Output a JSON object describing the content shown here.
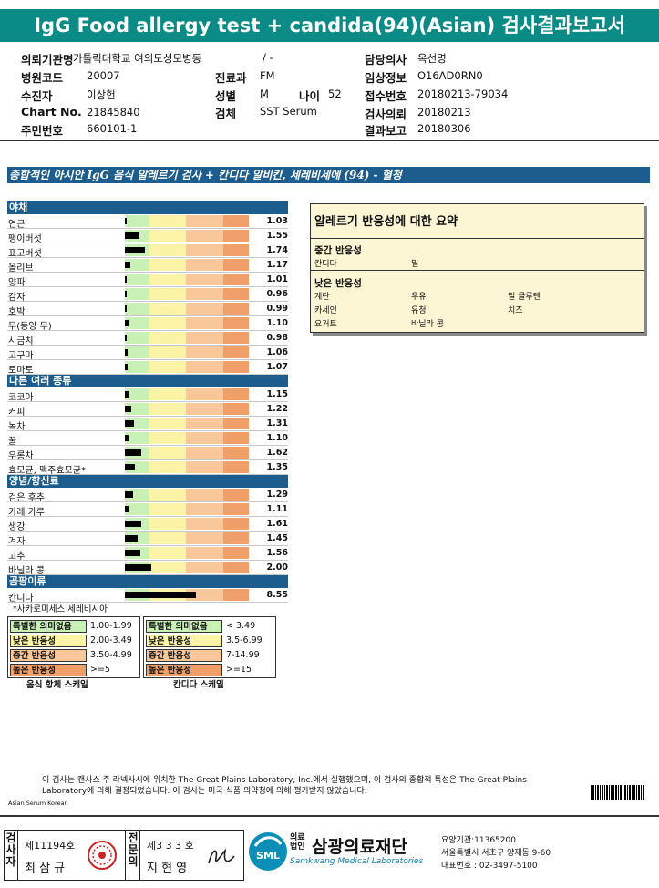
{
  "title": "IgG Food allergy test + candida(94)(Asian) 검사결과보고서",
  "patient_info": {
    "hospital_label": "의뢰기관명",
    "hospital_value": "가톨릭대학교 여의도성모병동",
    "ward_value": "/ -",
    "doctor_label": "담당의사",
    "doctor_value": "옥선명",
    "code_label": "병원코드",
    "code_value": "20007",
    "dept_label": "진료과",
    "dept_value": "FM",
    "clinical_label": "임상정보",
    "clinical_value": "O16AD0RN0",
    "collector_label": "수진자",
    "collector_value": "이상헌",
    "sex_label": "성별",
    "sex_value": "M",
    "age_label": "나이",
    "age_value": "52",
    "receipt_label": "접수번호",
    "receipt_value": "20180213-79034",
    "chart_label": "Chart No.",
    "chart_value": "21845840",
    "specimen_label": "검체",
    "specimen_value": "SST Serum",
    "request_label": "검사의뢰",
    "request_value": "20180213",
    "id_label": "주민번호",
    "id_value": "660101-1",
    "report_label": "결과보고",
    "report_value": "20180306"
  },
  "section_title": "종합적인 아시안 IgG 음식 알레르기 검사 + 칸디다 알비칸, 세레비세에 (94) - 혈청",
  "scale_header": "",
  "categories": [
    {
      "name": "야채",
      "items": [
        {
          "name": "연근",
          "value": "1.03",
          "level": 1.03
        },
        {
          "name": "팽이버섯",
          "value": "1.55",
          "level": 1.55
        },
        {
          "name": "표고버섯",
          "value": "1.74",
          "level": 1.74
        },
        {
          "name": "올리브",
          "value": "1.17",
          "level": 1.17
        },
        {
          "name": "양파",
          "value": "1.01",
          "level": 1.01
        },
        {
          "name": "감자",
          "value": "0.96",
          "level": 0.96
        },
        {
          "name": "호박",
          "value": "0.99",
          "level": 0.99
        },
        {
          "name": "무(동양 무)",
          "value": "1.10",
          "level": 1.1
        },
        {
          "name": "시금치",
          "value": "0.98",
          "level": 0.98
        },
        {
          "name": "고구마",
          "value": "1.06",
          "level": 1.06
        },
        {
          "name": "토마토",
          "value": "1.07",
          "level": 1.07
        }
      ]
    },
    {
      "name": "다른 여러 종류",
      "items": [
        {
          "name": "코코아",
          "value": "1.15",
          "level": 1.15
        },
        {
          "name": "커피",
          "value": "1.22",
          "level": 1.22
        },
        {
          "name": "녹차",
          "value": "1.31",
          "level": 1.31
        },
        {
          "name": "꿀",
          "value": "1.10",
          "level": 1.1
        },
        {
          "name": "우롱차",
          "value": "1.62",
          "level": 1.62
        },
        {
          "name": "효모균, 맥주효모균*",
          "value": "1.35",
          "level": 1.35
        }
      ]
    },
    {
      "name": "양념/향신료",
      "items": [
        {
          "name": "검은 후추",
          "value": "1.29",
          "level": 1.29
        },
        {
          "name": "카레 가루",
          "value": "1.11",
          "level": 1.11
        },
        {
          "name": "생강",
          "value": "1.61",
          "level": 1.61
        },
        {
          "name": "겨자",
          "value": "1.45",
          "level": 1.45
        },
        {
          "name": "고추",
          "value": "1.56",
          "level": 1.56
        },
        {
          "name": "바닐라 콩",
          "value": "2.00",
          "level": 2.0
        }
      ]
    },
    {
      "name": "곰팡이류",
      "items": [
        {
          "name": "칸디다",
          "value": "8.55",
          "level": 8.55,
          "candida": true
        }
      ]
    }
  ],
  "footnote": "*사카로미세스 세레비시아",
  "summary": {
    "heading": "알레르기 반응성에 대한 요약",
    "moderate_label": "중간 반응성",
    "moderate_items": [
      "칸디다",
      "밀"
    ],
    "low_label": "낮은 반응성",
    "low_items": [
      "계란",
      "우유",
      "밀 글루텐",
      "카세인",
      "유청",
      "치즈",
      "요거트",
      "바닐라 콩"
    ]
  },
  "legend_food": {
    "rows": [
      {
        "label": "특별한 의미없음",
        "range": "1.00-1.99",
        "color": "#c9f0b5"
      },
      {
        "label": "낮은 반응성",
        "range": "2.00-3.49",
        "color": "#fbf3a6"
      },
      {
        "label": "중간 반응성",
        "range": "3.50-4.99",
        "color": "#f8c79a"
      },
      {
        "label": "높은 반응성",
        "range": ">=5",
        "color": "#ef9f67"
      }
    ],
    "caption": "음식 항체 스케일"
  },
  "legend_candida": {
    "rows": [
      {
        "label": "특별한 의미없음",
        "range": "< 3.49",
        "color": "#c9f0b5"
      },
      {
        "label": "낮은 반응성",
        "range": "3.5-6.99",
        "color": "#fbf3a6"
      },
      {
        "label": "중간 반응성",
        "range": "7-14.99",
        "color": "#f8c79a"
      },
      {
        "label": "높은 반응성",
        "range": ">=15",
        "color": "#ef9f67"
      }
    ],
    "caption": "칸디다 스케일"
  },
  "disclaimer": "이 검사는 캔사스 주 라넥사시에 위치한 The Great Plains Laboratory, Inc.에서 실행했으며, 이 검사의 종합적 특성은 The Great Plains Laboratory에 의해 결정되었습니다. 이 검사는 미국 식품 의약청에 의해 평가받지 않았습니다.",
  "source_label": "Asian Serum Korean",
  "signatures": {
    "tester_label": "검사자",
    "tester_no": "제11194호",
    "tester_name": "최 삼 규",
    "reviewer_label": "전문의",
    "reviewer_no": "제3 3 3 호",
    "reviewer_name": "지 현 영"
  },
  "company": {
    "prefix_top": "의료",
    "prefix_bottom": "법인",
    "name": "삼광의료재단",
    "english": "Samkwang Medical Laboratories",
    "logo_text": "SML",
    "code": "요양기관:11365200",
    "address": "서울특별시 서초구 양재동 9-60",
    "phone": "대표번호 : 02-3497-5100"
  },
  "colors": {
    "title": "#0b8b86",
    "band": "#1d5d8d",
    "summary_bg": "#fdf6d4"
  }
}
